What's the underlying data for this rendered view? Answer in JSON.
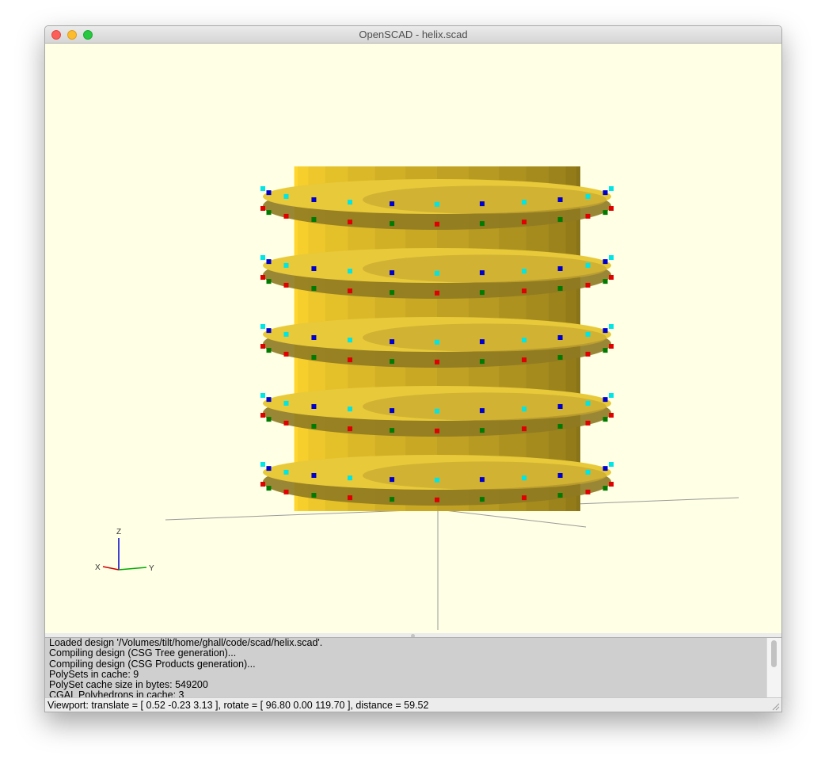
{
  "window": {
    "title": "OpenSCAD - helix.scad"
  },
  "viewport": {
    "background_color": "#ffffe5",
    "model_color": "#e8c93a",
    "vertex_marker_colors": [
      "#00e5e5",
      "#0000cc",
      "#e00000",
      "#007a00"
    ],
    "axes_labels": {
      "x": "X",
      "y": "Y",
      "z": "Z"
    },
    "axis_colors": {
      "x": "#cc0000",
      "y": "#00aa00",
      "z": "#0000cc"
    }
  },
  "console": {
    "lines": [
      "Loaded design '/Volumes/tilt/home/ghall/code/scad/helix.scad'.",
      "Compiling design (CSG Tree generation)...",
      "Compiling design (CSG Products generation)...",
      "PolySets in cache: 9",
      "PolySet cache size in bytes: 549200",
      "CGAL Polyhedrons in cache: 3"
    ]
  },
  "status": {
    "text": "Viewport: translate = [ 0.52 -0.23 3.13 ], rotate = [ 96.80 0.00 119.70 ], distance = 59.52"
  }
}
